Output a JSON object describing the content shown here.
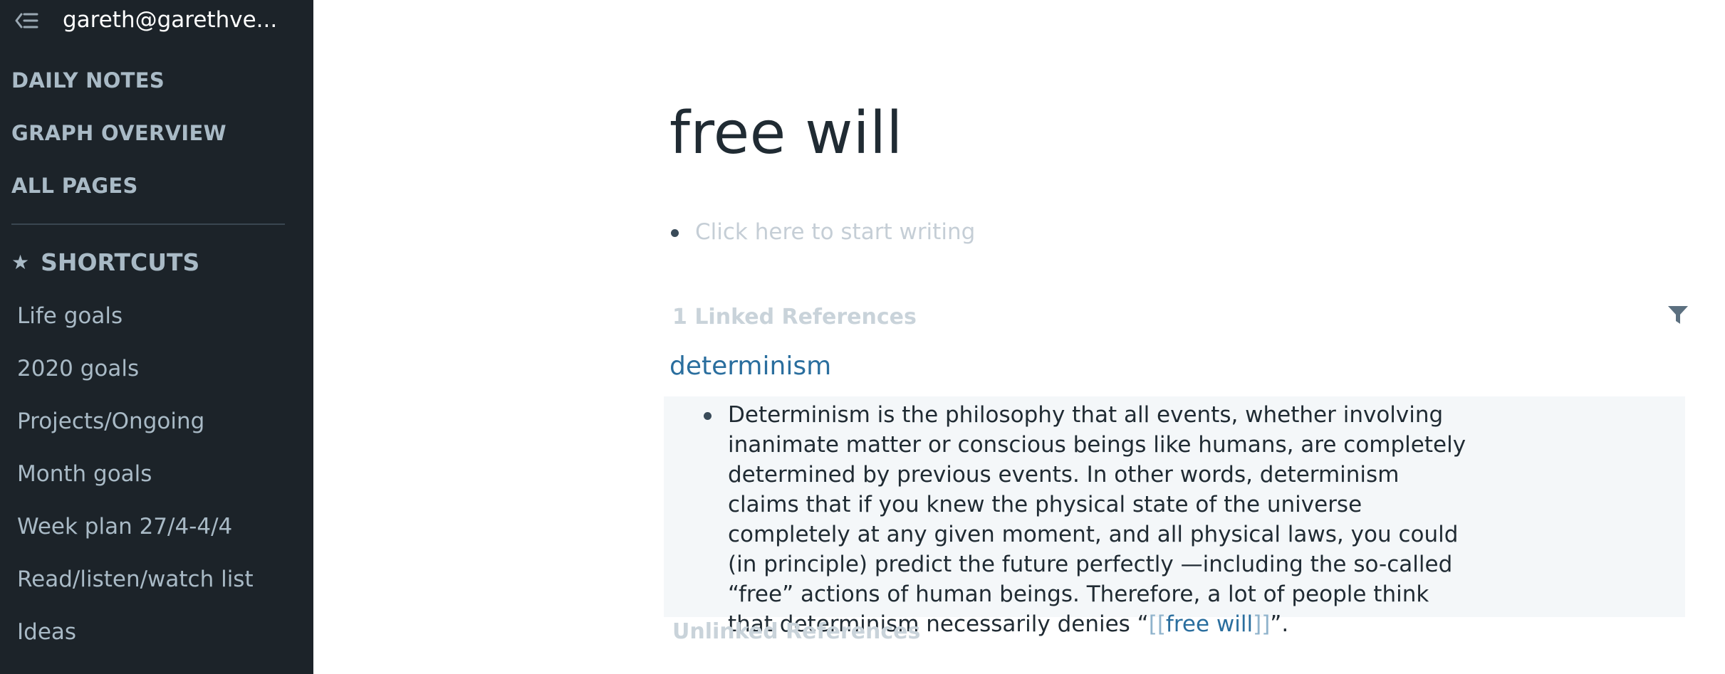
{
  "sidebar": {
    "user": "gareth@garethve...",
    "nav": [
      {
        "label": "DAILY NOTES"
      },
      {
        "label": "GRAPH OVERVIEW"
      },
      {
        "label": "ALL PAGES"
      }
    ],
    "shortcuts_title": "SHORTCUTS",
    "shortcuts": [
      {
        "label": "Life goals"
      },
      {
        "label": "2020 goals"
      },
      {
        "label": "Projects/Ongoing"
      },
      {
        "label": "Month goals"
      },
      {
        "label": "Week plan 27/4-4/4"
      },
      {
        "label": "Read/listen/watch list"
      },
      {
        "label": "Ideas"
      }
    ]
  },
  "main": {
    "title": "free will",
    "placeholder": "Click here to start writing",
    "linked_refs_title": "1 Linked References",
    "linked_refs": [
      {
        "page_title": "determinism",
        "block_text": "Determinism is the philosophy that all events, whether involving inanimate matter or conscious beings like humans, are completely determined by previous events. In other words, determinism claims that if you knew the physical state of the universe completely at any given moment, and all physical laws, you could (in principle) predict the future perfectly —including the so-called “free” actions of human beings. Therefore, a lot of people think that determinism necessarily denies “",
        "link_open": "[[",
        "link_text": "free will",
        "link_close": "]]",
        "block_suffix": "”."
      }
    ],
    "unlinked_refs_title": "Unlinked References"
  },
  "icons": {
    "collapse": "collapse-sidebar-icon",
    "star": "star-icon",
    "filter": "filter-icon"
  },
  "colors": {
    "sidebar_bg": "#1c2329",
    "link": "#2a6e9e",
    "ref_block_bg": "#f4f7f9"
  }
}
